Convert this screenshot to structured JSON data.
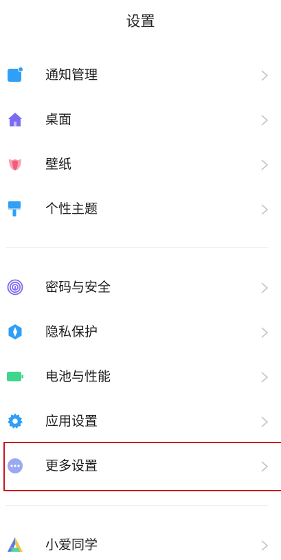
{
  "header": {
    "title": "设置"
  },
  "groups": [
    {
      "items": [
        {
          "label": "通知管理",
          "icon": "notification-icon",
          "color": "#2f9ff7"
        },
        {
          "label": "桌面",
          "icon": "home-icon",
          "color": "#7b6cf2"
        },
        {
          "label": "壁纸",
          "icon": "tulip-icon",
          "color": "#f0657b"
        },
        {
          "label": "个性主题",
          "icon": "paintbrush-icon",
          "color": "#2f9ff7"
        }
      ]
    },
    {
      "items": [
        {
          "label": "密码与安全",
          "icon": "fingerprint-icon",
          "color": "#7b6cf2"
        },
        {
          "label": "隐私保护",
          "icon": "privacy-shield-icon",
          "color": "#2f9ff7"
        },
        {
          "label": "电池与性能",
          "icon": "battery-icon",
          "color": "#3dd68c"
        },
        {
          "label": "应用设置",
          "icon": "gear-icon",
          "color": "#2f9ff7"
        },
        {
          "label": "更多设置",
          "icon": "more-dots-icon",
          "color": "#9aa8f0"
        }
      ]
    },
    {
      "items": [
        {
          "label": "小爱同学",
          "icon": "xiaoai-icon",
          "color": "#4a7cf6"
        }
      ]
    }
  ],
  "highlight": {
    "item": "更多设置",
    "color": "#c8161d"
  },
  "colors": {
    "chevron": "#c4c4c4",
    "divider": "#eeeeee"
  }
}
